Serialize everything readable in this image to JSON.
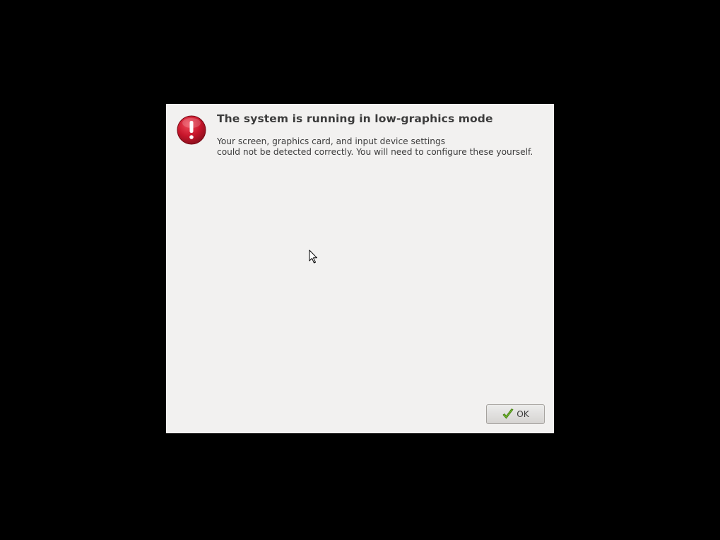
{
  "dialog": {
    "title": "The system is running in low-graphics mode",
    "message_line1": "Your screen, graphics card, and input device settings",
    "message_line2": "could not be detected correctly.  You will need to configure these yourself.",
    "icon": "error-exclamation-icon",
    "ok_button": {
      "label": "OK",
      "icon": "checkmark-icon"
    }
  },
  "colors": {
    "screen_background": "#000000",
    "dialog_background": "#f2f1f0",
    "error_red": "#c7162b",
    "check_green": "#4e9a06"
  },
  "cursor": {
    "icon": "mouse-pointer-icon"
  }
}
